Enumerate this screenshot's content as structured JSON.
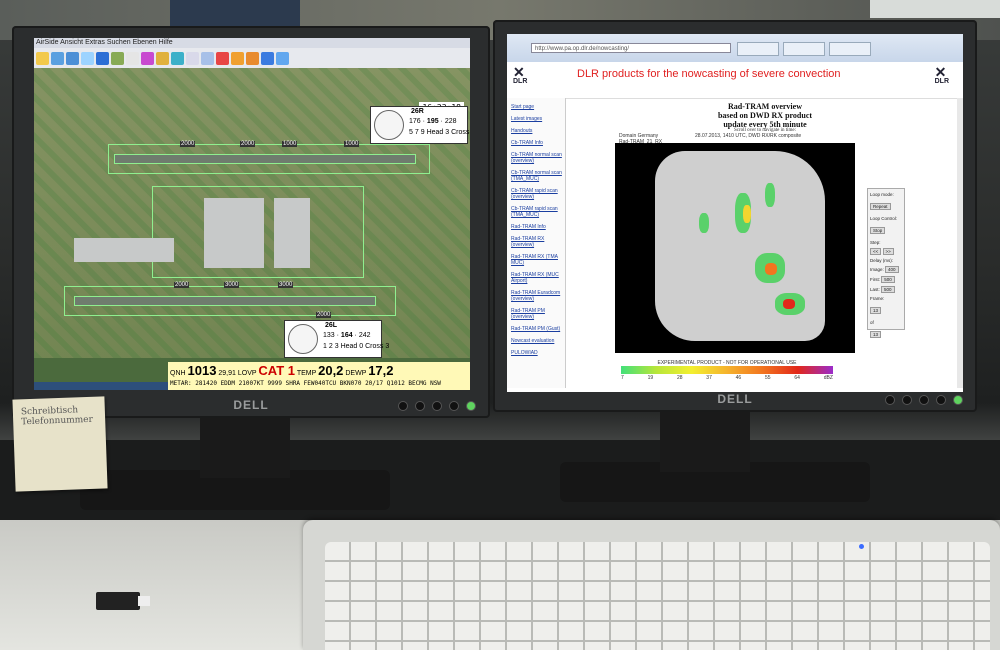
{
  "left_screen": {
    "menu": [
      "AirSide",
      "Ansicht",
      "Extras",
      "Suchen",
      "Ebenen",
      "Hilfe"
    ],
    "clock": "16:23:18",
    "runway_north": {
      "name": "26R",
      "left": "176",
      "mid": "195",
      "right": "228",
      "l2": "5",
      "m2": "7",
      "r2": "9",
      "head_label": "Head",
      "head_value": "3",
      "cross_label": "Cross",
      "cross_value": "7"
    },
    "runway_south": {
      "name": "26L",
      "left": "133",
      "mid": "164",
      "right": "242",
      "l2": "1",
      "m2": "2",
      "r2": "3",
      "head_label": "Head",
      "head_value": "0",
      "cross_label": "Cross",
      "cross_value": "3"
    },
    "distances": [
      "2000",
      "2000",
      "1000",
      "1000",
      "2000",
      "3000",
      "3000",
      "2000"
    ],
    "weather": {
      "qnh_label": "QNH",
      "qnh_value": "1013",
      "qnh_inhg": "29,91",
      "lvp_label": "LOVP",
      "cat": "CAT 1",
      "temp_label": "TEMP",
      "temp_value": "20,2",
      "dewp_label": "DEWP",
      "dewp_value": "17,2",
      "metar": "METAR: 281420 EDDM 21007KT 9999 SHRA FEW040TCU BKN070 20/17 Q1012 BECMG NSW"
    }
  },
  "right_screen": {
    "address": "http://www.pa.op.dlr.de/nowcasting/",
    "page_title": "DLR products for the nowcasting of severe convection",
    "logo_text": "DLR",
    "sidebar_links": [
      "Start page",
      "Latest images",
      "Handouts",
      "Cb-TRAM Info",
      "Cb-TRAM normal scan (overview)",
      "Cb-TRAM normal scan (TMA_MUC)",
      "Cb-TRAM rapid scan (overview)",
      "Cb-TRAM rapid scan (TMA_MUC)",
      "Rad-TRAM Info",
      "Rad-TRAM RX (overview)",
      "Rad-TRAM RX (TMA MUC)",
      "Rad-TRAM RX (MUC Airport)",
      "Rad-TRAM Euradcom (overview)",
      "Rad-TRAM PM (overview)",
      "Rad-TRAM PM (Gust)",
      "Nowcast evaluation",
      "PULOWIAD"
    ],
    "overview": {
      "title": "Rad-TRAM overview",
      "line2": "based on DWD RX product",
      "line3": "update every 5th minute",
      "scroll_hint": "Scroll over to navigate in time:",
      "domain": "Domain Germany",
      "product": "Rad-TRAM_21_RX",
      "timestamp": "28.07.2013, 1410 UTC, DWD RX/RK composite",
      "colorbar_note": "EXPERIMENTAL PRODUCT - NOT FOR OPERATIONAL USE",
      "colorbar_ticks": [
        "7",
        "19",
        "28",
        "37",
        "46",
        "55",
        "64",
        "dBZ"
      ]
    },
    "loop_panel": {
      "mode_label": "Loop mode:",
      "mode_value": "Repeat",
      "control_label": "Loop Control:",
      "stop": "Stop",
      "step_label": "Step:",
      "delay_label": "Delay (ms):",
      "image_label": "Image:",
      "image_value": "400",
      "first_label": "First:",
      "first_value": "500",
      "last_label": "Last:",
      "last_value": "500",
      "frame_label": "Frame:",
      "frame_value": "13",
      "of_label": "of",
      "of_value": "13"
    }
  },
  "monitor_brand": "DELL",
  "sticky_note": "Schreibtisch Telefonnummer"
}
